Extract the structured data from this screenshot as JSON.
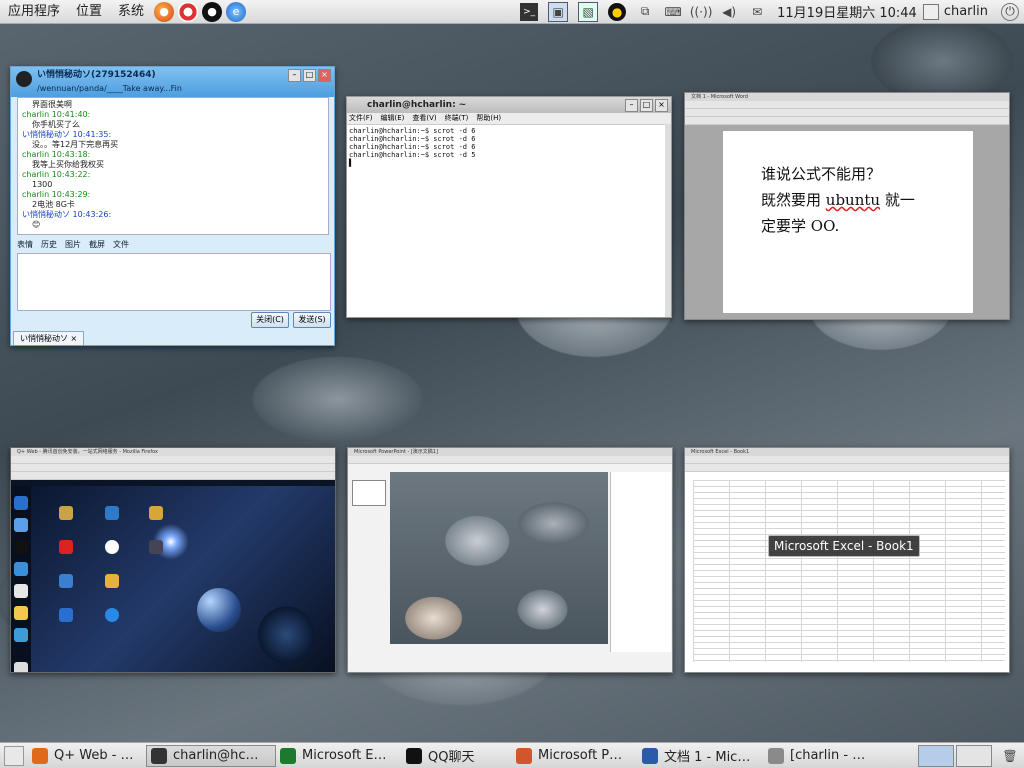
{
  "top_panel": {
    "menus": [
      "应用程序",
      "位置",
      "系统"
    ],
    "launchers": [
      "firefox-icon",
      "help-lifebuoy-icon",
      "qq-penguin-icon",
      "ie-icon"
    ],
    "tray": [
      "terminal-icon",
      "screenshot-icon",
      "photo-icon",
      "qq-penguin-icon",
      "network-icon",
      "keyboard-icon",
      "wireless-icon",
      "volume-icon",
      "mail-icon"
    ],
    "clock": "11月19日星期六 10:44",
    "user": "charlin"
  },
  "qq_window": {
    "title": "い悄悄秘动ソ(279152464)",
    "subtitle": "/wennuan/panda/____Take away...Fin",
    "messages": [
      {
        "type": "text",
        "text": "界面很美啊"
      },
      {
        "type": "green",
        "text": "charlin 10:41:40:"
      },
      {
        "type": "text",
        "text": "你手机买了么"
      },
      {
        "type": "blue",
        "text": "い悄悄秘动ソ 10:41:35:"
      },
      {
        "type": "text",
        "text": "没。。等12月下完息再买"
      },
      {
        "type": "green",
        "text": "charlin 10:43:18:"
      },
      {
        "type": "text",
        "text": "我等上买你给我权买"
      },
      {
        "type": "green",
        "text": "charlin 10:43:22:"
      },
      {
        "type": "text",
        "text": "1300"
      },
      {
        "type": "green",
        "text": "charlin 10:43:29:"
      },
      {
        "type": "text",
        "text": "2电池 8G卡"
      },
      {
        "type": "blue",
        "text": "い悄悄秘动ソ 10:43:26:"
      },
      {
        "type": "text",
        "text": "😊"
      }
    ],
    "toolbar": [
      "表情",
      "历史",
      "图片",
      "截屏",
      "文件"
    ],
    "close_label": "关闭(C)",
    "send_label": "发送(S)",
    "tab_label": "い悄悄秘动ソ"
  },
  "terminal_window": {
    "title": "charlin@hcharlin: ~",
    "menu": [
      "文件(F)",
      "编辑(E)",
      "查看(V)",
      "终端(T)",
      "帮助(H)"
    ],
    "lines": [
      "charlin@hcharlin:~$ scrot -d 6",
      "charlin@hcharlin:~$ scrot -d 6",
      "charlin@hcharlin:~$ scrot -d 6",
      "charlin@hcharlin:~$ scrot -d 5"
    ]
  },
  "word_window": {
    "title": "文档 1 - Microsoft Word",
    "line1": "谁说公式不能用？",
    "line2_a": "既然要用 ",
    "line2_b": "ubuntu",
    "line2_c": " 就一",
    "line3": "定要学 OO."
  },
  "firefox_window": {
    "title": "Q+ Web - 腾讯首创免安装，一站式网络服务 - Mozilla Firefox"
  },
  "ppt_window": {
    "title": "Microsoft PowerPoint - [演示文稿1]"
  },
  "excel_window": {
    "title": "Microsoft Excel - Book1",
    "tooltip": "Microsoft Excel - Book1"
  },
  "taskbar": {
    "tasks": [
      {
        "label": "Q+ Web - …",
        "icon": "firefox-icon",
        "color": "#e06a1b",
        "active": false
      },
      {
        "label": "charlin@hc…",
        "icon": "terminal-icon",
        "color": "#333333",
        "active": true
      },
      {
        "label": "Microsoft E…",
        "icon": "excel-icon",
        "color": "#1d7a2c",
        "active": false
      },
      {
        "label": "QQ聊天",
        "icon": "qq-penguin-icon",
        "color": "#111111",
        "active": false
      },
      {
        "label": "Microsoft P…",
        "icon": "powerpoint-icon",
        "color": "#d2552b",
        "active": false
      },
      {
        "label": "文档 1 - Mic…",
        "icon": "word-icon",
        "color": "#2a5aa8",
        "active": false
      },
      {
        "label": "[charlin - …",
        "icon": "file-manager-icon",
        "color": "#8a8a8a",
        "active": false
      }
    ]
  }
}
